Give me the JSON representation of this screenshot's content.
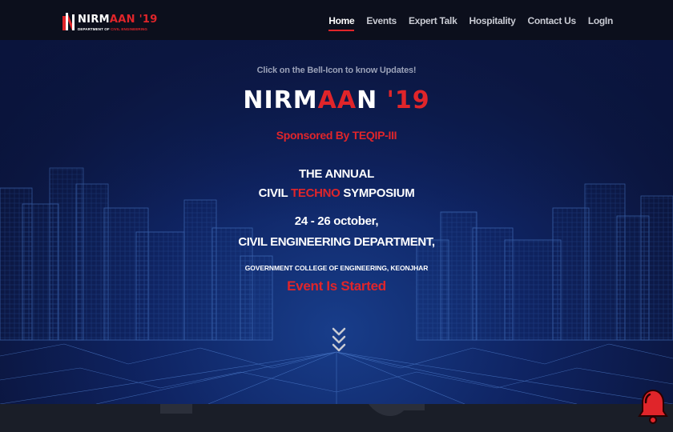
{
  "navbar": {
    "logo": {
      "title_main": "NIRM",
      "title_accent": "AAN",
      "title_year": " '19",
      "subtitle_main": "DEPARTMENT OF ",
      "subtitle_accent": "CIVIL ENGINEERING"
    },
    "items": [
      {
        "label": "Home",
        "active": true
      },
      {
        "label": "Events",
        "active": false
      },
      {
        "label": "Expert Talk",
        "active": false
      },
      {
        "label": "Hospitality",
        "active": false
      },
      {
        "label": "Contact Us",
        "active": false
      },
      {
        "label": "LogIn",
        "active": false
      }
    ]
  },
  "hero": {
    "updates_hint": "Click on the Bell-Icon to know Updates!",
    "title_part1": "NIRM",
    "title_part2": "AA",
    "title_part3": "N ",
    "title_part4": "'19",
    "sponsor": "Sponsored By TEQIP-III",
    "annual_line1": "THE ANNUAL",
    "annual_line2_a": "CIVIL ",
    "annual_line2_b": "TECHNO",
    "annual_line2_c": " SYMPOSIUM",
    "dates": "24 - 26 october,",
    "department": "CIVIL ENGINEERING DEPARTMENT,",
    "college": "GOVERNMENT COLLEGE OF ENGINEERING, KEONJHAR",
    "status": "Event Is Started"
  },
  "icons": {
    "scroll_down": "chevron-double-down-icon",
    "bell": "bell-icon"
  },
  "colors": {
    "accent": "#e0252a",
    "navbar_bg": "#0c0f1c",
    "hero_bg": "#0f2463"
  }
}
